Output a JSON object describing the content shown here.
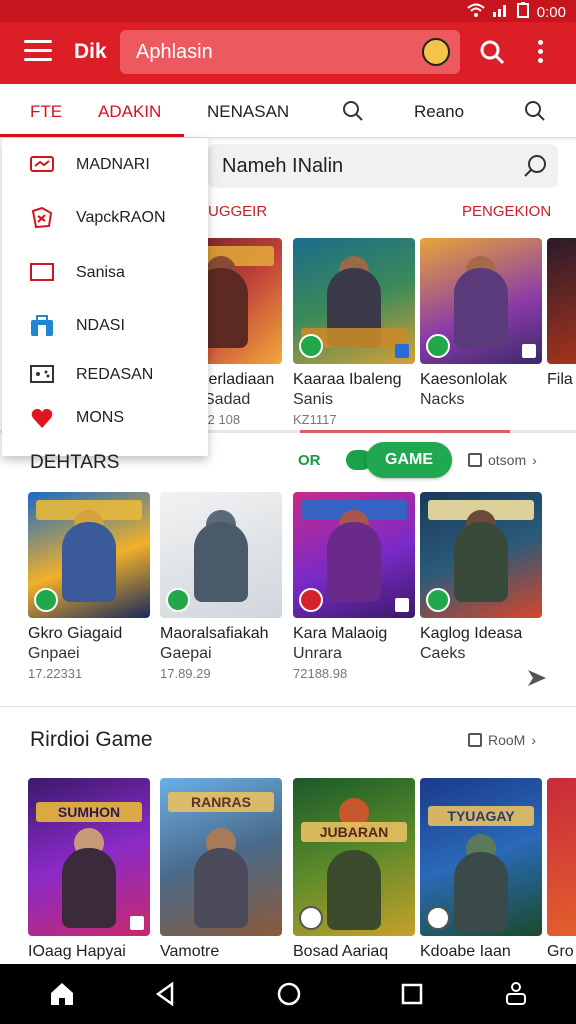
{
  "status": {
    "time": "0:00"
  },
  "appbar": {
    "brand": "Dik",
    "search_text": "Aphlasin"
  },
  "tabs": [
    {
      "label": "FTE"
    },
    {
      "label": "ADAKIN"
    },
    {
      "label": "NENASAN"
    },
    {
      "label": "Reano"
    }
  ],
  "sub_search": {
    "text": "Nameh INalin"
  },
  "section1": {
    "left_label": "UGGEIR",
    "right_label": "PENGEKION"
  },
  "dropdown": [
    {
      "label": "MADNARI",
      "icon": "mail-icon"
    },
    {
      "label": "VapckRAON",
      "icon": "share-icon"
    },
    {
      "label": "Sanisa",
      "icon": "window-icon"
    },
    {
      "label": "NDASI",
      "icon": "bag-icon"
    },
    {
      "label": "REDASAN",
      "icon": "controller-icon"
    },
    {
      "label": "MONS",
      "icon": "heart-icon"
    }
  ],
  "row1": [
    {
      "name": "Ierladiaan",
      "sub": "Sadad",
      "meta": "I2 108"
    },
    {
      "name": "Kaaraa Ibaleng",
      "sub": "Sanis",
      "meta": "KZ1117"
    },
    {
      "name": "Kaesonlolak",
      "sub": "Nacks",
      "meta": ""
    },
    {
      "name": "Fila",
      "sub": "",
      "meta": ""
    }
  ],
  "section2": {
    "title": "DEHTARS",
    "or_label": "OR",
    "game_label": "GAME",
    "more_label": "otsom"
  },
  "row2": [
    {
      "name": "Gkro Giagaid",
      "sub": "Gnpaei",
      "meta": "17.22331"
    },
    {
      "name": "Maoralsafiakah",
      "sub": "Gaepai",
      "meta": "17.89.29"
    },
    {
      "name": "Kara Malaoig",
      "sub": "Unrara",
      "meta": "72188.98"
    },
    {
      "name": "Kaglog Ideasa",
      "sub": "Caeks",
      "meta": ""
    }
  ],
  "section3": {
    "title": "Rirdioi Game",
    "more_label": "RooM"
  },
  "row3": [
    {
      "name": "IOaag Hapyai",
      "banner": "SUMHON"
    },
    {
      "name": "Vamotre",
      "banner": "RANRAS"
    },
    {
      "name": "Bosad Aariaq",
      "banner": "JUBARAN"
    },
    {
      "name": "Kdoabe Iaan",
      "banner": "TYUAGAY"
    },
    {
      "name": "Gro",
      "banner": ""
    }
  ],
  "colors": {
    "primary": "#dc1f26",
    "accent_green": "#1fa84f",
    "nav": "#000000"
  }
}
